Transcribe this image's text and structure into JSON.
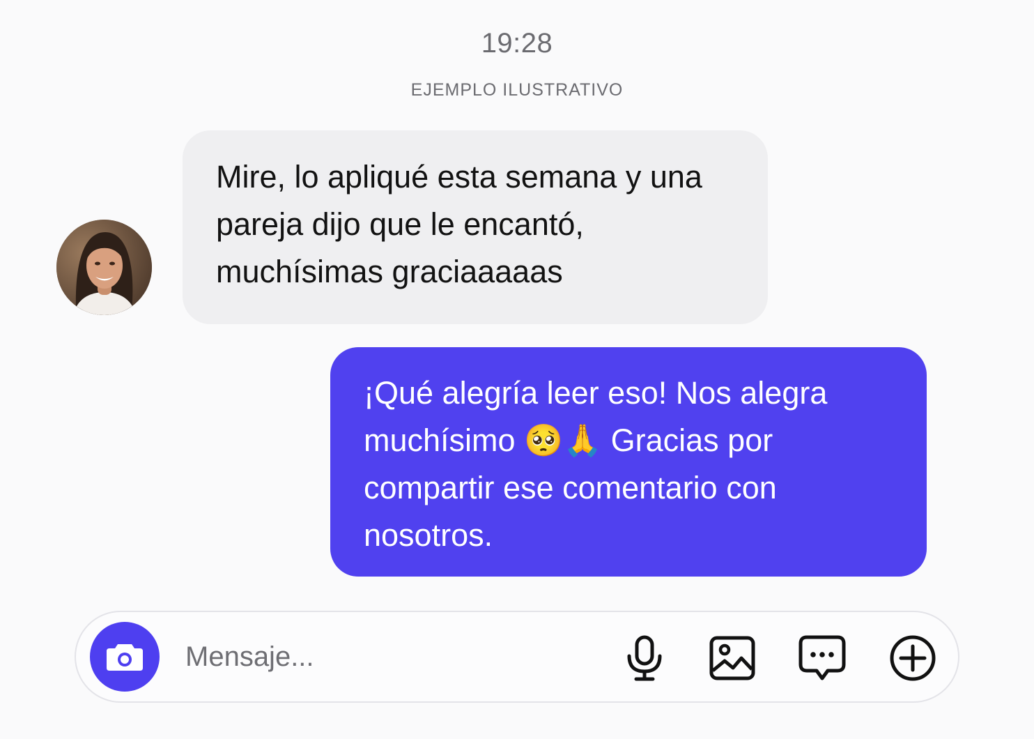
{
  "header": {
    "time": "19:28",
    "label": "EJEMPLO ILUSTRATIVO"
  },
  "messages": [
    {
      "direction": "incoming",
      "sender_avatar": "contact-avatar-photo",
      "lines": [
        "Mire, lo apliqué esta semana y una",
        "pareja dijo que le encantó,",
        "muchísimas graciaaaaas"
      ]
    },
    {
      "direction": "outgoing",
      "line1": "¡Qué alegría leer eso! Nos alegra",
      "line2_before_emoji": "muchísimo ",
      "line2_emoji": "🥺🙏",
      "line2_after_emoji": " Gracias por",
      "line3": "compartir ese comentario con",
      "line4": "nosotros."
    }
  ],
  "composer": {
    "placeholder": "Mensaje...",
    "camera_icon": "camera-icon",
    "actions": [
      "microphone-icon",
      "image-icon",
      "sticker-chat-icon",
      "add-icon"
    ]
  },
  "colors": {
    "accent": "#5041ef",
    "incoming_bubble": "#efeff1",
    "background": "#fafafb",
    "secondary_text": "#6b6b70"
  }
}
